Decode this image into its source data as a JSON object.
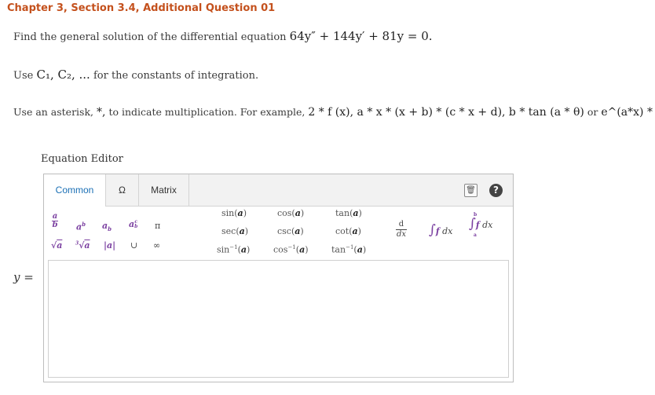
{
  "chapter_title": "Chapter 3, Section 3.4, Additional Question 01",
  "question": {
    "line1_text": "Find the general solution of the differential equation",
    "line1_math": "64y″ + 144y′ + 81y = 0.",
    "line2_text": "Use",
    "line2_math": "C₁, C₂, ...",
    "line2_tail": "for the constants of integration.",
    "line3_text": "Use an asterisk,",
    "line3_asterisk": "*,",
    "line3_mid": "to indicate multiplication. For example,",
    "line3_math": "2 * f (x), a * x * (x + b) * (c * x + d), b * tan (a * θ)",
    "line3_or": "or",
    "line3_tail_math": "e^(a*x) * b."
  },
  "editor": {
    "label": "Equation Editor",
    "tabs": [
      "Common",
      "Ω",
      "Matrix"
    ],
    "active_tab": "Common",
    "trash_icon": "trash-icon",
    "help_icon": "help-icon",
    "palette": {
      "row1": [
        "a/b",
        "a^b",
        "a_b",
        "a_b^c",
        "π",
        "sin(a)",
        "cos(a)",
        "tan(a)"
      ],
      "row2": [
        "sec(a)",
        "csc(a)",
        "cot(a)"
      ],
      "row3": [
        "√a",
        "∛a",
        "|a|",
        "∪",
        "∞",
        "sin⁻¹(a)",
        "cos⁻¹(a)",
        "tan⁻¹(a)"
      ],
      "derivative": "d/dx",
      "integral": "∫ f dx",
      "definite_integral": "∫ₐᵇ f dx"
    },
    "answer_label": "y =",
    "answer_value": ""
  }
}
